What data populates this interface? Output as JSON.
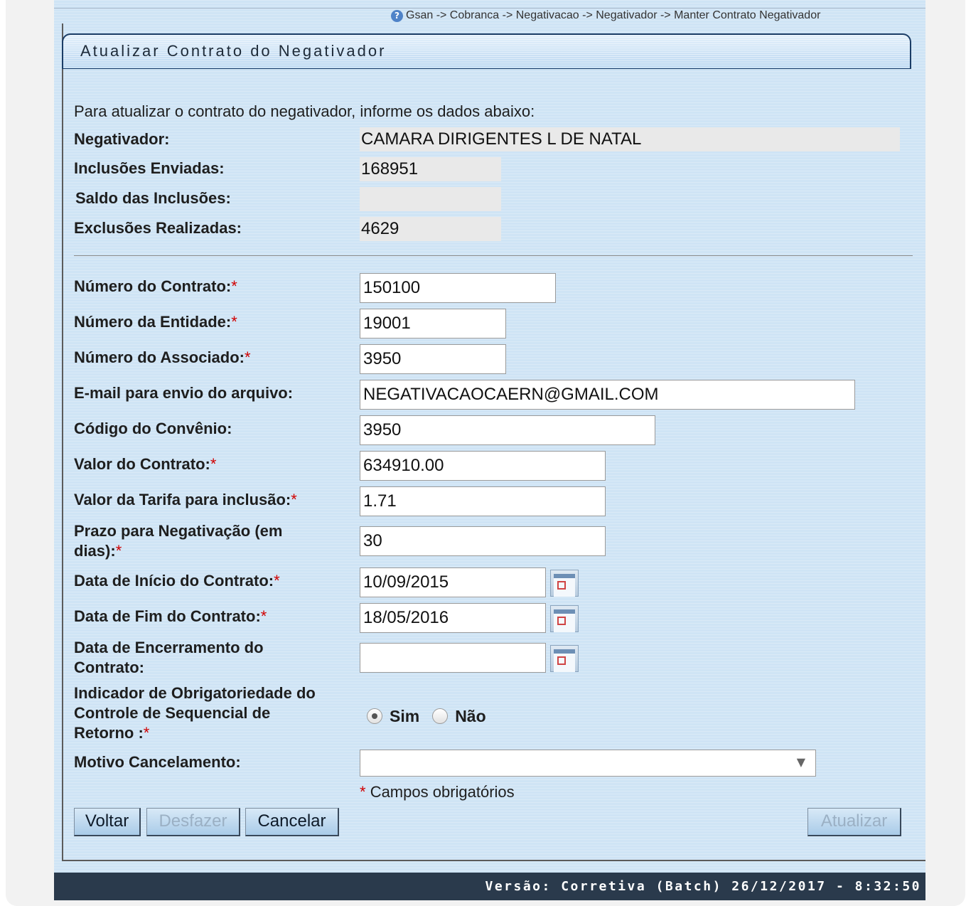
{
  "breadcrumb": "Gsan -> Cobranca -> Negativacao -> Negativador -> Manter Contrato Negativador",
  "header": {
    "title": "Atualizar Contrato do Negativador"
  },
  "intro": "Para atualizar o contrato do negativador, informe os dados abaixo:",
  "info": {
    "negativador": {
      "label": "Negativador:",
      "value": "CAMARA DIRIGENTES L DE NATAL"
    },
    "inclusoes_enviadas": {
      "label": "Inclusões Enviadas:",
      "value": "168951"
    },
    "saldo_inclusoes": {
      "label": "Saldo das Inclusões:",
      "value": ""
    },
    "exclusoes_realizadas": {
      "label": "Exclusões Realizadas:",
      "value": "4629"
    }
  },
  "form": {
    "numero_contrato": {
      "label": "Número do Contrato:",
      "value": "150100"
    },
    "numero_entidade": {
      "label": "Número da Entidade:",
      "value": "19001"
    },
    "numero_associado": {
      "label": "Número do Associado:",
      "value": "3950"
    },
    "email": {
      "label": "E-mail para envio do arquivo:",
      "value": "NEGATIVACAOCAERN@GMAIL.COM"
    },
    "codigo_convenio": {
      "label": "Código do Convênio:",
      "value": "3950"
    },
    "valor_contrato": {
      "label": "Valor do Contrato:",
      "value": "634910.00"
    },
    "valor_tarifa": {
      "label": "Valor da Tarifa para inclusão:",
      "value": "1.71"
    },
    "prazo": {
      "label_line1": "Prazo para Negativação (em",
      "label_line2": "dias):",
      "value": "30"
    },
    "data_inicio": {
      "label": "Data de Início do Contrato:",
      "value": "10/09/2015"
    },
    "data_fim": {
      "label": "Data de Fim do Contrato:",
      "value": "18/05/2016"
    },
    "data_encerramento": {
      "label_line1": "Data de Encerramento do",
      "label_line2": "Contrato:",
      "value": ""
    },
    "indicador": {
      "label_line1": "Indicador de Obrigatoriedade do",
      "label_line2": "Controle de Sequencial de",
      "label_line3": "Retorno :",
      "option_sim": "Sim",
      "option_nao": "Não",
      "selected": "Sim"
    },
    "motivo_cancelamento": {
      "label": "Motivo Cancelamento:",
      "value": ""
    },
    "required_mark": "*",
    "required_note": "Campos obrigatórios"
  },
  "buttons": {
    "voltar": "Voltar",
    "desfazer": "Desfazer",
    "cancelar": "Cancelar",
    "atualizar": "Atualizar"
  },
  "footer": "Versão: Corretiva (Batch) 26/12/2017 - 8:32:50",
  "icons": {
    "help": "help-circle-icon",
    "calendar": "calendar-icon",
    "dropdown": "chevron-down-icon"
  },
  "colors": {
    "page_background": "#cfe4f5",
    "footer_background": "#2a3a4c",
    "required": "#d00000"
  }
}
